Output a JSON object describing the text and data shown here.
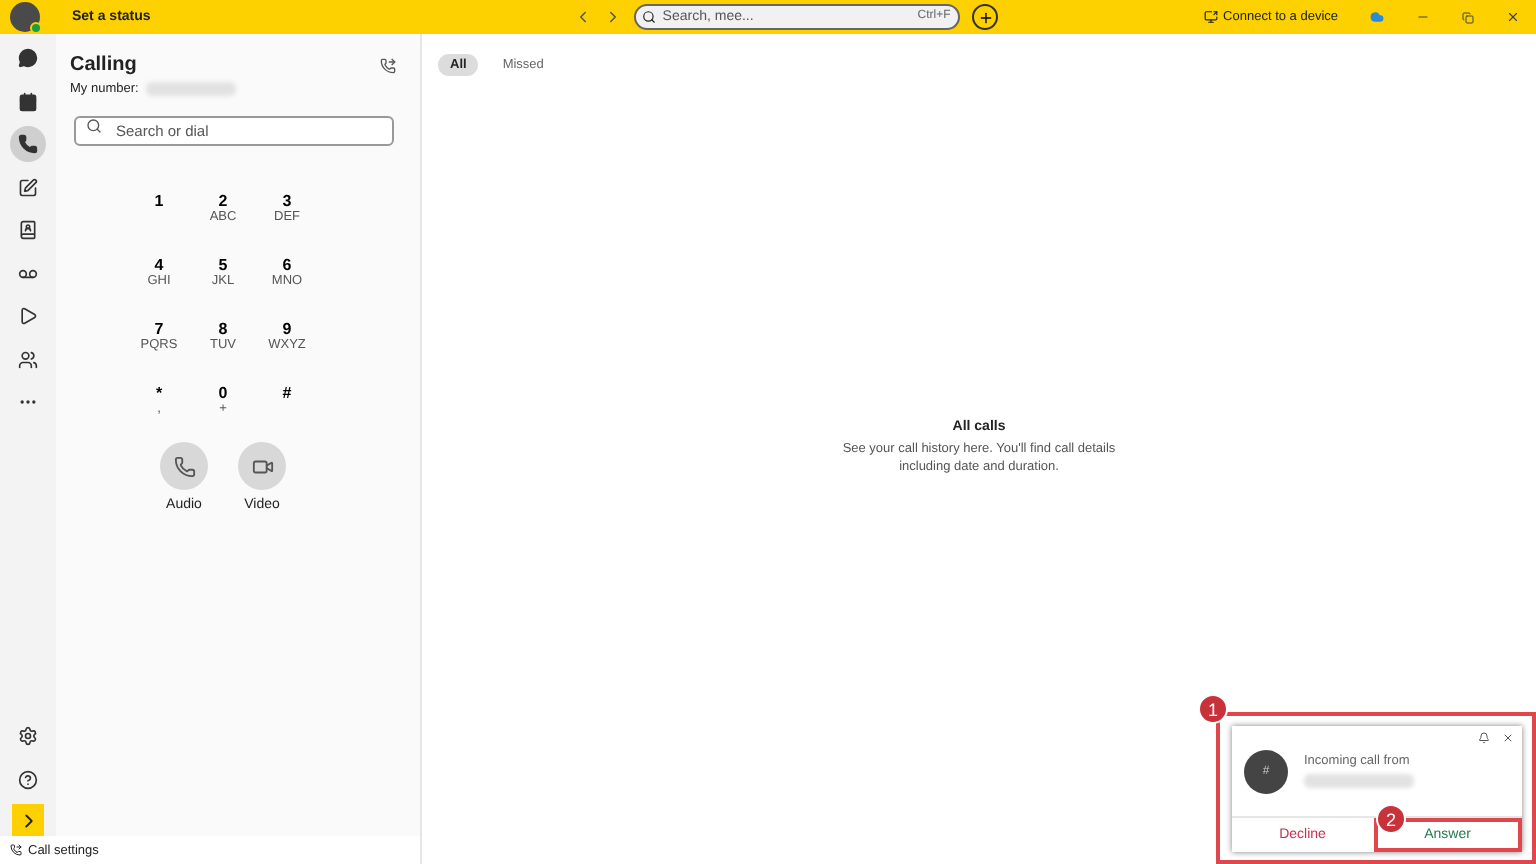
{
  "topbar": {
    "status": "Set a status",
    "search_placeholder": "Search, mee...",
    "search_shortcut": "Ctrl+F",
    "connect": "Connect to a device"
  },
  "sidebar": {
    "items": [
      {
        "kind": "chat",
        "selected": false
      },
      {
        "kind": "calendar",
        "selected": false
      },
      {
        "kind": "calls",
        "selected": true
      },
      {
        "kind": "compose",
        "selected": false
      },
      {
        "kind": "contacts",
        "selected": false
      },
      {
        "kind": "voicemail",
        "selected": false
      },
      {
        "kind": "media",
        "selected": false
      },
      {
        "kind": "people",
        "selected": false
      },
      {
        "kind": "more",
        "selected": false
      }
    ],
    "bottom": [
      {
        "kind": "settings"
      },
      {
        "kind": "help"
      },
      {
        "kind": "expand"
      }
    ]
  },
  "calling": {
    "title": "Calling",
    "number_label": "My number:",
    "search_placeholder": "Search or dial",
    "keys": [
      {
        "digit": "1"
      },
      {
        "digit": "2",
        "letters": "ABC"
      },
      {
        "digit": "3",
        "letters": "DEF"
      },
      {
        "digit": "4",
        "letters": "GHI"
      },
      {
        "digit": "5",
        "letters": "JKL"
      },
      {
        "digit": "6",
        "letters": "MNO"
      },
      {
        "digit": "7",
        "letters": "PQRS"
      },
      {
        "digit": "8",
        "letters": "TUV"
      },
      {
        "digit": "9",
        "letters": "WXYZ"
      },
      {
        "digit": "*",
        "letters": ","
      },
      {
        "digit": "0",
        "letters": "+"
      },
      {
        "digit": "#"
      }
    ],
    "actions": [
      {
        "kind": "audio",
        "label": "Audio"
      },
      {
        "kind": "video",
        "label": "Video"
      }
    ],
    "settings": "Call settings"
  },
  "history": {
    "tabs": [
      {
        "label": "All",
        "selected": true
      },
      {
        "label": "Missed",
        "selected": false
      }
    ],
    "empty_title": "All calls",
    "empty_text": "See your call history here. You'll find call details including date and duration."
  },
  "incoming": {
    "avatar": "#",
    "text": "Incoming call from",
    "decline": "Decline",
    "answer": "Answer",
    "markers": [
      "1",
      "2"
    ]
  }
}
